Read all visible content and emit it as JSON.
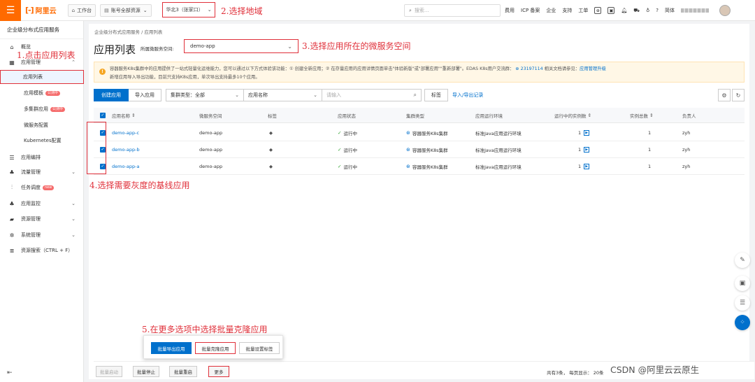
{
  "topbar": {
    "logo_text": "阿里云",
    "workbench": "工作台",
    "account_scope": "账号全部资源",
    "region": "华北3（张家口）",
    "search_placeholder": "搜索...",
    "links": [
      "费用",
      "ICP 备案",
      "企业",
      "支持",
      "工单"
    ],
    "lang": "简体"
  },
  "sidebar": {
    "title": "企业级分布式应用服务",
    "items": [
      {
        "label": "概览",
        "icon": "home-icon"
      },
      {
        "label": "应用管理",
        "icon": "grid-icon"
      },
      {
        "label": "应用列表"
      },
      {
        "label": "应用模板",
        "badge": "公测中"
      },
      {
        "label": "多集群应用",
        "badge": "公测中"
      },
      {
        "label": "微服务配置"
      },
      {
        "label": "Kubernetes配置"
      },
      {
        "label": "应用编排",
        "icon": "layers-icon"
      },
      {
        "label": "流量管理",
        "icon": "traffic-icon"
      },
      {
        "label": "任务调度",
        "icon": "schedule-icon",
        "badge": "new"
      },
      {
        "label": "应用监控",
        "icon": "monitor-icon"
      },
      {
        "label": "资源管理",
        "icon": "folder-icon"
      },
      {
        "label": "系统管理",
        "icon": "gear-icon"
      },
      {
        "label": "资源搜索（CTRL + F）",
        "icon": "search-list-icon"
      }
    ]
  },
  "breadcrumb": "企业级分布式应用服务  /  应用列表",
  "page_title": "应用列表",
  "namespace": {
    "label": "所属微服务空间:",
    "value": "demo-app"
  },
  "notice": {
    "line1": "容器服务K8s集群中的应用提供了一站式轻量化运维能力，您可以通过以下方式体验该功能：① 创建全新应用；② 在存量应用的应用详情页面单击\"体验新版\"或\"部署应用\"\"重新部署\"。EDAS K8s用户交流群：",
    "group": "23197114",
    "line1_tail": "相关文档请参见：",
    "doc_link": "应用管理升级",
    "line2": "新增应用导入导出功能，目前只支持K8s应用，单次导出支持最多10个应用。"
  },
  "toolbar": {
    "create": "创建应用",
    "import": "导入应用",
    "cluster_type": "集群类型：全部",
    "app_name": "应用名称",
    "input_placeholder": "请输入",
    "tag": "标签",
    "import_export_log": "导入/导出记录"
  },
  "table": {
    "headers": [
      "应用名称",
      "微服务空间",
      "标签",
      "应用状态",
      "集群类型",
      "应用运行环境",
      "运行中的实例数",
      "实例总数",
      "负责人"
    ],
    "rows": [
      {
        "name": "demo-app-c",
        "ns": "demo-app",
        "status": "运行中",
        "cluster": "容器服务K8s集群",
        "env": "标准Java应用运行环境",
        "running": "1",
        "total": "1",
        "owner": "zyh"
      },
      {
        "name": "demo-app-b",
        "ns": "demo-app",
        "status": "运行中",
        "cluster": "容器服务K8s集群",
        "env": "标准Java应用运行环境",
        "running": "1",
        "total": "1",
        "owner": "zyh"
      },
      {
        "name": "demo-app-a",
        "ns": "demo-app",
        "status": "运行中",
        "cluster": "容器服务K8s集群",
        "env": "标准Java应用运行环境",
        "running": "1",
        "total": "1",
        "owner": "zyh"
      }
    ]
  },
  "popover": {
    "export": "批量导出应用",
    "clone": "批量克隆应用",
    "tags": "批量设置标签"
  },
  "bottombar": {
    "start": "批量启动",
    "stop": "批量停止",
    "restart": "批量重启",
    "more": "更多",
    "pager": "共有3条，  每页显示：  20条"
  },
  "annotations": {
    "a1": "1.点击应用列表",
    "a2": "2.选择地域",
    "a3": "3.选择应用所在的微服务空间",
    "a4": "4.选择需要灰度的基线应用",
    "a5": "5.在更多选项中选择批量克隆应用"
  },
  "watermark": "CSDN @阿里云云原生",
  "colors": {
    "brand": "#ff6a00",
    "primary": "#0070cc",
    "annotation": "#e0303a"
  }
}
